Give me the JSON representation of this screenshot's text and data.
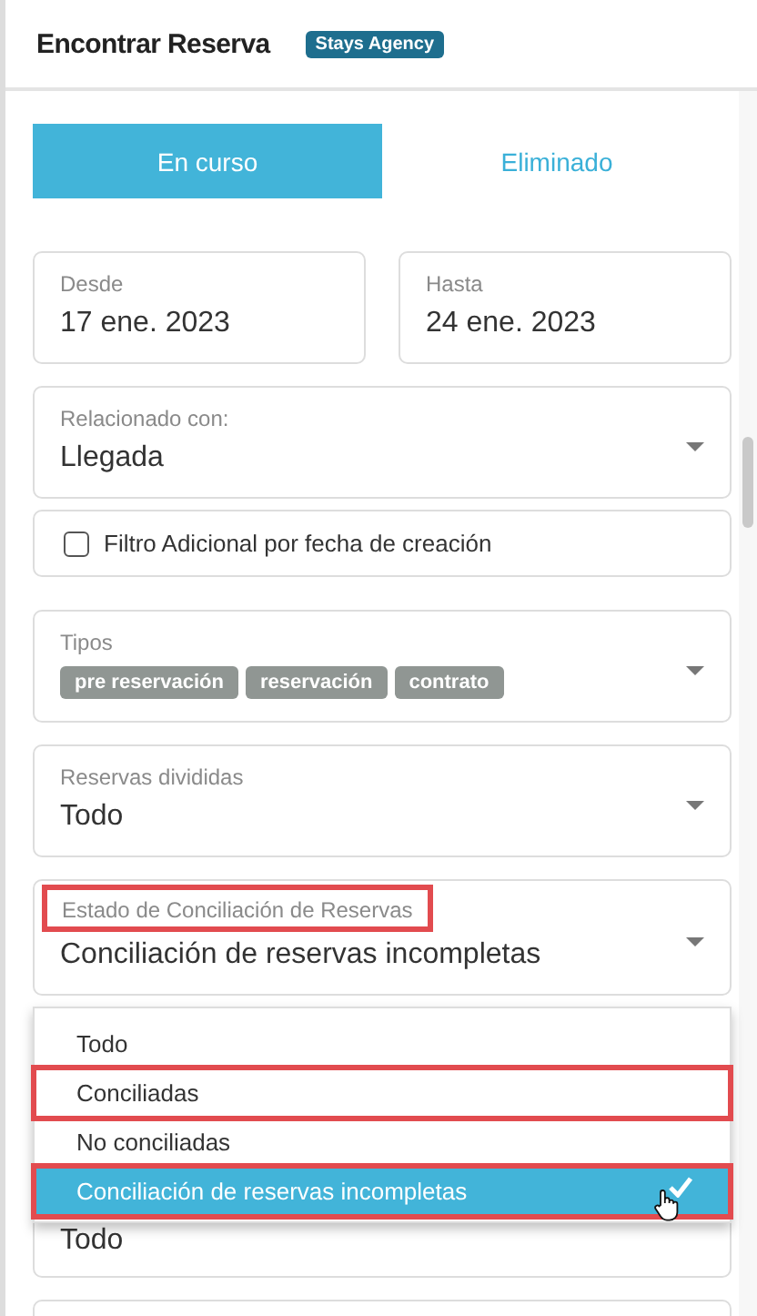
{
  "header": {
    "title": "Encontrar Reserva",
    "badge": "Stays Agency"
  },
  "tabs": [
    {
      "label": "En curso",
      "selected": true
    },
    {
      "label": "Eliminado",
      "selected": false
    }
  ],
  "dates": [
    {
      "label": "Desde",
      "value": "17 ene. 2023"
    },
    {
      "label": "Hasta",
      "value": "24 ene. 2023"
    }
  ],
  "related": {
    "label": "Relacionado con:",
    "value": "Llegada"
  },
  "creation_filter": {
    "label": "Filtro Adicional por fecha de creación",
    "checked": false
  },
  "types": {
    "label": "Tipos",
    "chips": [
      "pre reservación",
      "reservación",
      "contrato"
    ]
  },
  "split": {
    "label": "Reservas divididas",
    "value": "Todo"
  },
  "reconciliation": {
    "label": "Estado de Conciliación de Reservas",
    "highlighted": true,
    "value": "Conciliación de reservas incompletas",
    "options": [
      {
        "label": "Todo",
        "selected": false,
        "highlighted": false
      },
      {
        "label": "Conciliadas",
        "selected": false,
        "highlighted": true
      },
      {
        "label": "No conciliadas",
        "selected": false,
        "highlighted": false
      },
      {
        "label": "Conciliación de reservas incompletas",
        "selected": true,
        "highlighted": true
      }
    ]
  },
  "next_field": {
    "value": "Todo"
  }
}
